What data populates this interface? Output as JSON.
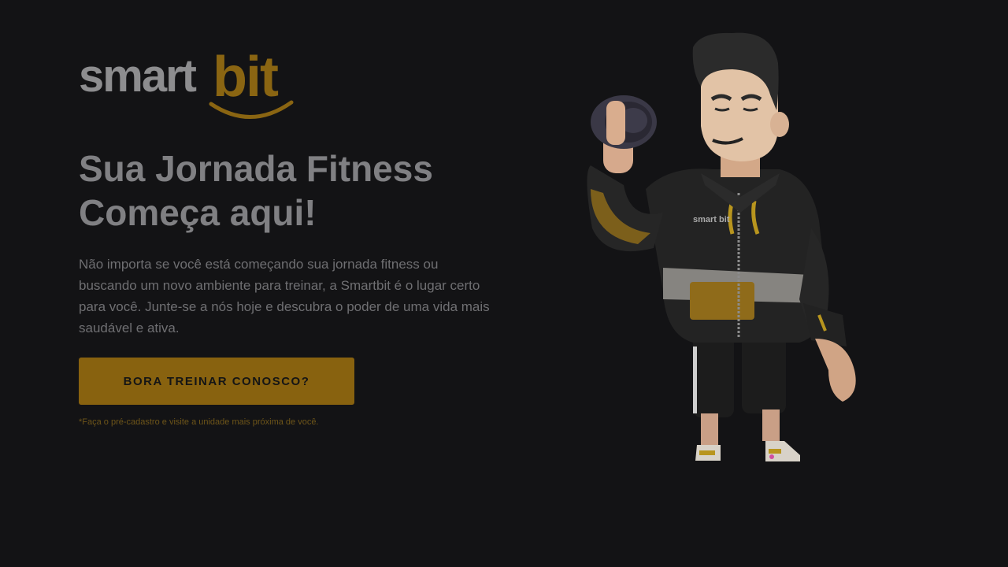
{
  "logo": {
    "part1": "smart",
    "part2": "bit"
  },
  "hero": {
    "title_line1": "Sua Jornada Fitness",
    "title_line2": "Começa aqui!",
    "description": "Não importa se você está começando sua jornada fitness ou buscando um novo ambiente para treinar, a Smartbit é o lugar certo para você. Junte-se a nós hoje e descubra o poder de uma vida mais saudável e ativa.",
    "cta_label": "BORA TREINAR CONOSCO?",
    "note": "*Faça o pré-cadastro e visite a unidade mais próxima de você."
  },
  "mascot": {
    "jacket_logo": "smart bit"
  },
  "colors": {
    "background": "#131315",
    "brand_gold": "#88620f",
    "text_gray": "#808083"
  }
}
